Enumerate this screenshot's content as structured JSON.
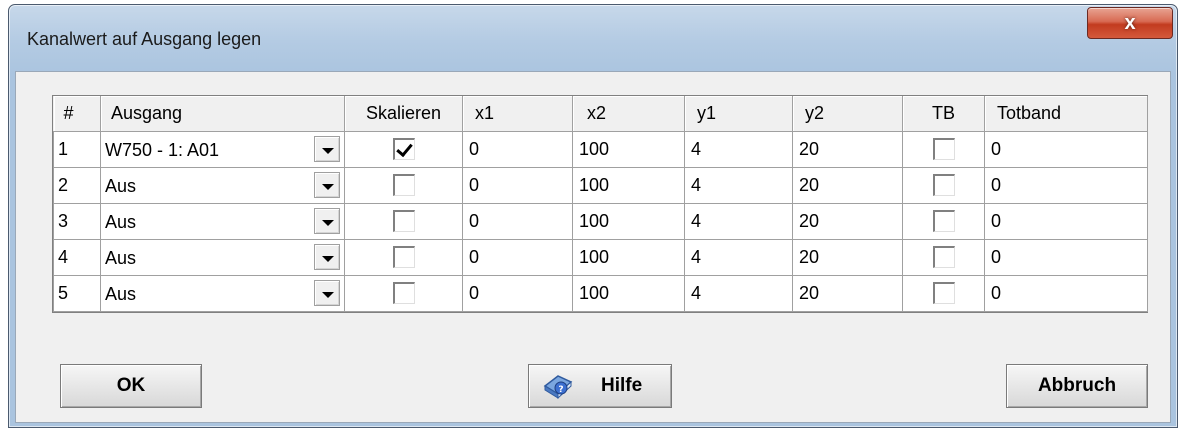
{
  "window": {
    "title": "Kanalwert auf Ausgang legen",
    "close_glyph": "x"
  },
  "table": {
    "headers": [
      "#",
      "Ausgang",
      "Skalieren",
      "x1",
      "x2",
      "y1",
      "y2",
      "TB",
      "Totband"
    ],
    "rows": [
      {
        "num": "1",
        "ausgang": "W750 - 1: A01",
        "skalieren": true,
        "x1": "0",
        "x2": "100",
        "y1": "4",
        "y2": "20",
        "tb": false,
        "totband": "0"
      },
      {
        "num": "2",
        "ausgang": "Aus",
        "skalieren": false,
        "x1": "0",
        "x2": "100",
        "y1": "4",
        "y2": "20",
        "tb": false,
        "totband": "0"
      },
      {
        "num": "3",
        "ausgang": "Aus",
        "skalieren": false,
        "x1": "0",
        "x2": "100",
        "y1": "4",
        "y2": "20",
        "tb": false,
        "totband": "0"
      },
      {
        "num": "4",
        "ausgang": "Aus",
        "skalieren": false,
        "x1": "0",
        "x2": "100",
        "y1": "4",
        "y2": "20",
        "tb": false,
        "totband": "0"
      },
      {
        "num": "5",
        "ausgang": "Aus",
        "skalieren": false,
        "x1": "0",
        "x2": "100",
        "y1": "4",
        "y2": "20",
        "tb": false,
        "totband": "0"
      }
    ]
  },
  "buttons": {
    "ok_label": "OK",
    "help_label": "Hilfe",
    "cancel_label": "Abbruch",
    "help_icon": "help-book-icon"
  },
  "colors": {
    "title_gradient": "#b4cbe3",
    "close_button": "#c23b1f",
    "client_bg": "#f0f0f0"
  }
}
